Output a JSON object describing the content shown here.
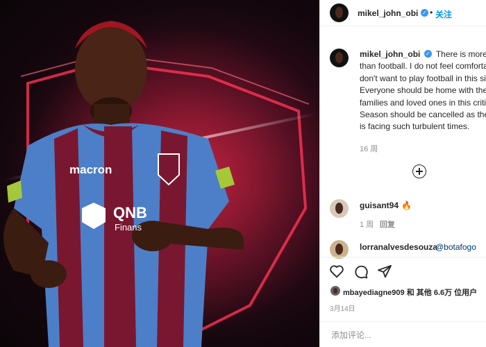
{
  "post": {
    "username": "mikel_john_obi",
    "follow_label": "关注",
    "caption_user": "mikel_john_obi",
    "caption_text": "There is more to life than football. I do not feel comfortable and don't want to play football in this situation. Everyone should be home with their families and loved ones in this critical time. Season should be cancelled as the world is facing such turbulent times.",
    "caption_time": "16 周",
    "photo": {
      "sponsor_brand": "macron",
      "sponsor_main": "QNB",
      "sponsor_sub": "Finans"
    }
  },
  "comments": [
    {
      "username": "guisant94",
      "emoji": "🔥",
      "time": "1 周",
      "reply_label": "回复"
    },
    {
      "username": "lorranalvesdesouza",
      "mention": "@botafogo"
    }
  ],
  "likes": {
    "liker": "mbayediagne909",
    "text": "和 其他 6.6万 位用户"
  },
  "date": "3月14日",
  "add_comment": {
    "placeholder": "添加评论..."
  },
  "icons": [
    "heart-icon",
    "comment-icon",
    "share-icon",
    "add-icon",
    "verified-icon"
  ]
}
